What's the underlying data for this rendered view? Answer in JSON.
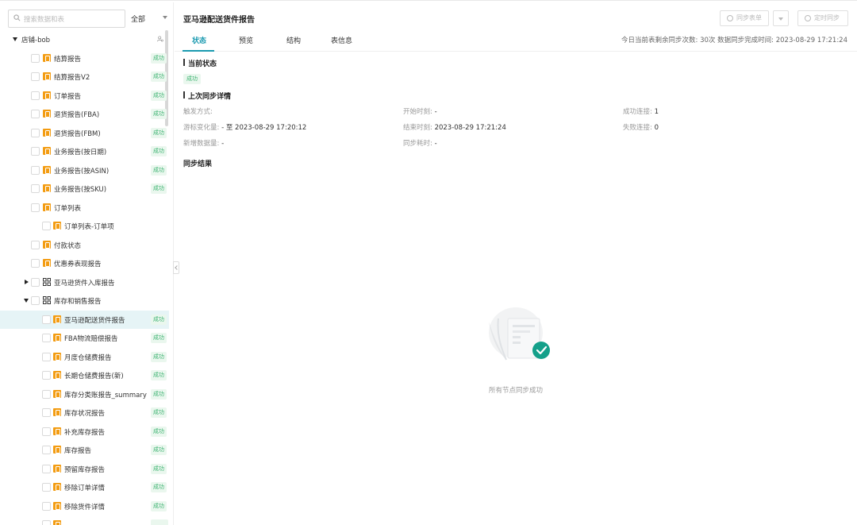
{
  "sidebar": {
    "search_placeholder": "搜索数据和表",
    "filter_value": "全部",
    "shop_label": "店铺-bob",
    "rows": [
      {
        "label": "结算报告",
        "badge": "成功"
      },
      {
        "label": "结算报告V2",
        "badge": "成功"
      },
      {
        "label": "订单报告",
        "badge": "成功"
      },
      {
        "label": "退货报告(FBA)",
        "badge": "成功"
      },
      {
        "label": "退货报告(FBM)",
        "badge": "成功"
      },
      {
        "label": "业务报告(按日期)",
        "badge": "成功"
      },
      {
        "label": "业务报告(按ASIN)",
        "badge": "成功"
      },
      {
        "label": "业务报告(按SKU)",
        "badge": "成功"
      },
      {
        "label": "订单列表",
        "badge": ""
      },
      {
        "label": "订单列表-订单项",
        "badge": ""
      },
      {
        "label": "付款状态",
        "badge": ""
      },
      {
        "label": "优惠券表现报告",
        "badge": ""
      },
      {
        "label": "亚马逊货件入库报告",
        "badge": ""
      },
      {
        "label": "库存和销售报告",
        "badge": ""
      },
      {
        "label": "亚马逊配送货件报告",
        "badge": "成功"
      },
      {
        "label": "FBA物流赔偿报告",
        "badge": "成功"
      },
      {
        "label": "月度仓储费报告",
        "badge": "成功"
      },
      {
        "label": "长期仓储费报告(新)",
        "badge": "成功"
      },
      {
        "label": "库存分类账报告_summary",
        "badge": "成功"
      },
      {
        "label": "库存状况报告",
        "badge": "成功"
      },
      {
        "label": "补充库存报告",
        "badge": "成功"
      },
      {
        "label": "库存报告",
        "badge": "成功"
      },
      {
        "label": "预留库存报告",
        "badge": "成功"
      },
      {
        "label": "移除订单详情",
        "badge": "成功"
      },
      {
        "label": "移除货件详情",
        "badge": "成功"
      }
    ]
  },
  "header": {
    "title": "亚马逊配送货件报告",
    "sync_table_label": "同步表单",
    "scheduled_sync_label": "定时同步"
  },
  "tabs": [
    {
      "label": "状态"
    },
    {
      "label": "预览"
    },
    {
      "label": "结构"
    },
    {
      "label": "表信息"
    }
  ],
  "sync_info": {
    "remaining_label": "今日当前表剩余同步次数:",
    "remaining_value": "30次",
    "completed_label": "数据同步完成时间:",
    "completed_value": "2023-08-29 17:21:24"
  },
  "current_status": {
    "title": "当前状态",
    "status": "成功"
  },
  "last_sync": {
    "title": "上次同步详情",
    "trigger_label": "触发方式:",
    "trigger_value": "",
    "cursor_label": "游标变化量:",
    "cursor_value": "- 至 2023-08-29 17:20:12",
    "added_label": "新增数据量:",
    "added_value": "-",
    "start_label": "开始时刻:",
    "start_value": "-",
    "end_label": "结束时刻:",
    "end_value": "2023-08-29 17:21:24",
    "duration_label": "同步耗时:",
    "duration_value": "-",
    "success_label": "成功连接:",
    "success_value": "1",
    "fail_label": "失败连接:",
    "fail_value": "0"
  },
  "result": {
    "title": "同步结果",
    "empty_text": "所有节点同步成功"
  }
}
